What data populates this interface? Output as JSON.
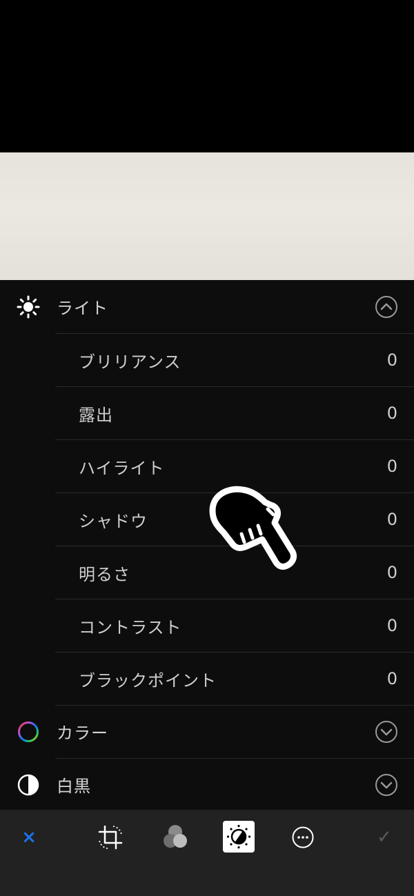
{
  "sections": {
    "light": {
      "label": "ライト",
      "icon": "sun-icon",
      "expanded": true
    },
    "color": {
      "label": "カラー",
      "icon": "color-wheel-icon",
      "expanded": false
    },
    "bw": {
      "label": "白黒",
      "icon": "half-circle-icon",
      "expanded": false
    }
  },
  "light_items": [
    {
      "label": "ブリリアンス",
      "value": "0"
    },
    {
      "label": "露出",
      "value": "0"
    },
    {
      "label": "ハイライト",
      "value": "0"
    },
    {
      "label": "シャドウ",
      "value": "0"
    },
    {
      "label": "明るさ",
      "value": "0"
    },
    {
      "label": "コントラスト",
      "value": "0"
    },
    {
      "label": "ブラックポイント",
      "value": "0"
    }
  ],
  "toolbar": {
    "cancel_label": "×",
    "done_label": "✓",
    "tools": [
      "crop-rotate-icon",
      "filters-icon",
      "adjust-icon",
      "more-icon"
    ],
    "active_tool": "adjust-icon"
  },
  "colors": {
    "accent": "#1a73e8",
    "panel_bg": "#0d0d0d",
    "toolbar_bg": "#222222"
  }
}
